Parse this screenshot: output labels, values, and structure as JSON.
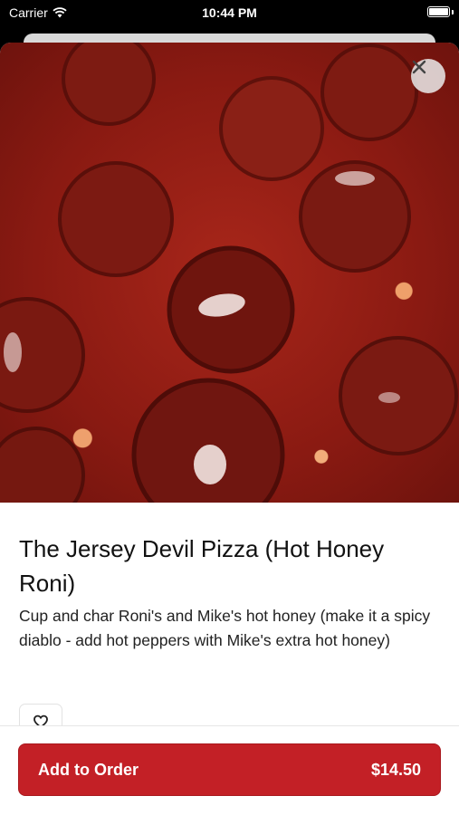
{
  "status_bar": {
    "carrier": "Carrier",
    "time": "10:44 PM"
  },
  "item": {
    "image_alt": "pepperoni pizza close-up",
    "title": "The Jersey Devil Pizza (Hot Honey Roni)",
    "description": "Cup and char Roni's and Mike's hot honey (make it a spicy diablo - add hot peppers with Mike's extra hot honey)"
  },
  "footer": {
    "add_label": "Add to Order",
    "price": "$14.50"
  },
  "icons": {
    "close": "close-icon",
    "favorite": "heart-icon",
    "wifi": "wifi-icon",
    "battery": "battery-icon"
  },
  "colors": {
    "accent": "#c32026"
  }
}
